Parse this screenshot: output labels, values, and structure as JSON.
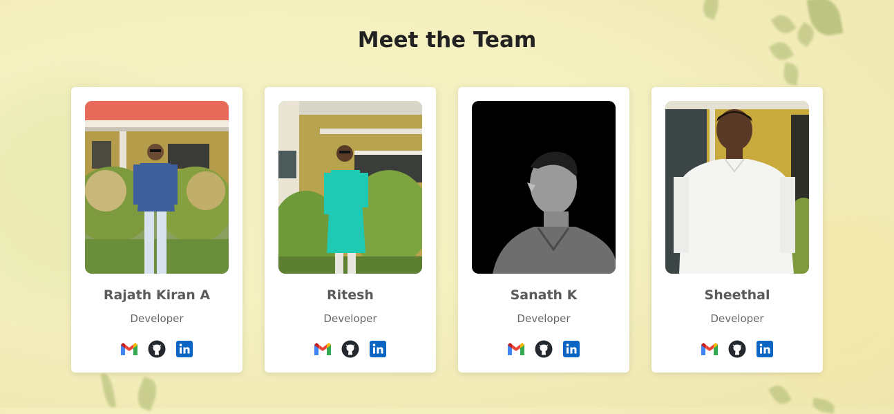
{
  "page": {
    "title": "Meet the Team"
  },
  "colors": {
    "gmail_red": "#EA4335",
    "gmail_blue": "#4285F4",
    "gmail_green": "#34A853",
    "gmail_yellow": "#FBBC04",
    "github": "#24292f",
    "linkedin": "#0A66C2"
  },
  "icons": {
    "email": "gmail-icon",
    "github": "github-icon",
    "linkedin": "linkedin-icon"
  },
  "team": [
    {
      "name": "Rajath Kiran A",
      "role": "Developer"
    },
    {
      "name": "Ritesh",
      "role": "Developer"
    },
    {
      "name": "Sanath K",
      "role": "Developer"
    },
    {
      "name": "Sheethal",
      "role": "Developer"
    }
  ]
}
